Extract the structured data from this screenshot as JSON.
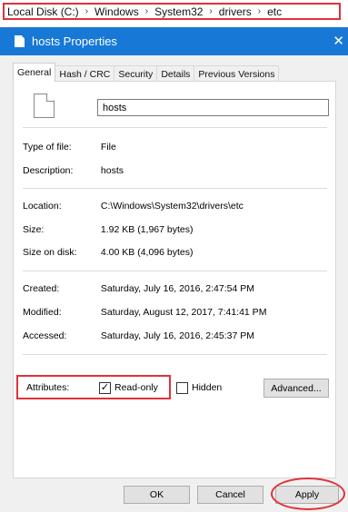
{
  "breadcrumb": [
    "Local Disk (C:)",
    "Windows",
    "System32",
    "drivers",
    "etc"
  ],
  "window": {
    "title": "hosts Properties",
    "close": "✕"
  },
  "tabs": [
    "General",
    "Hash / CRC",
    "Security",
    "Details",
    "Previous Versions"
  ],
  "file_name": "hosts",
  "info": {
    "type_label": "Type of file:",
    "type_value": "File",
    "desc_label": "Description:",
    "desc_value": "hosts",
    "location_label": "Location:",
    "location_value": "C:\\Windows\\System32\\drivers\\etc",
    "size_label": "Size:",
    "size_value": "1.92 KB (1,967 bytes)",
    "sizedisk_label": "Size on disk:",
    "sizedisk_value": "4.00 KB (4,096 bytes)",
    "created_label": "Created:",
    "created_value": "Saturday, July 16, 2016, 2:47:54 PM",
    "modified_label": "Modified:",
    "modified_value": "Saturday, August 12, 2017, 7:41:41 PM",
    "accessed_label": "Accessed:",
    "accessed_value": "Saturday, July 16, 2016, 2:45:37 PM"
  },
  "attributes": {
    "label": "Attributes:",
    "readonly_label": "Read-only",
    "readonly_checked": true,
    "hidden_label": "Hidden",
    "hidden_checked": false,
    "advanced_label": "Advanced..."
  },
  "buttons": {
    "ok": "OK",
    "cancel": "Cancel",
    "apply": "Apply"
  },
  "colors": {
    "titlebar": "#1778d6",
    "highlight": "#e0313a"
  }
}
